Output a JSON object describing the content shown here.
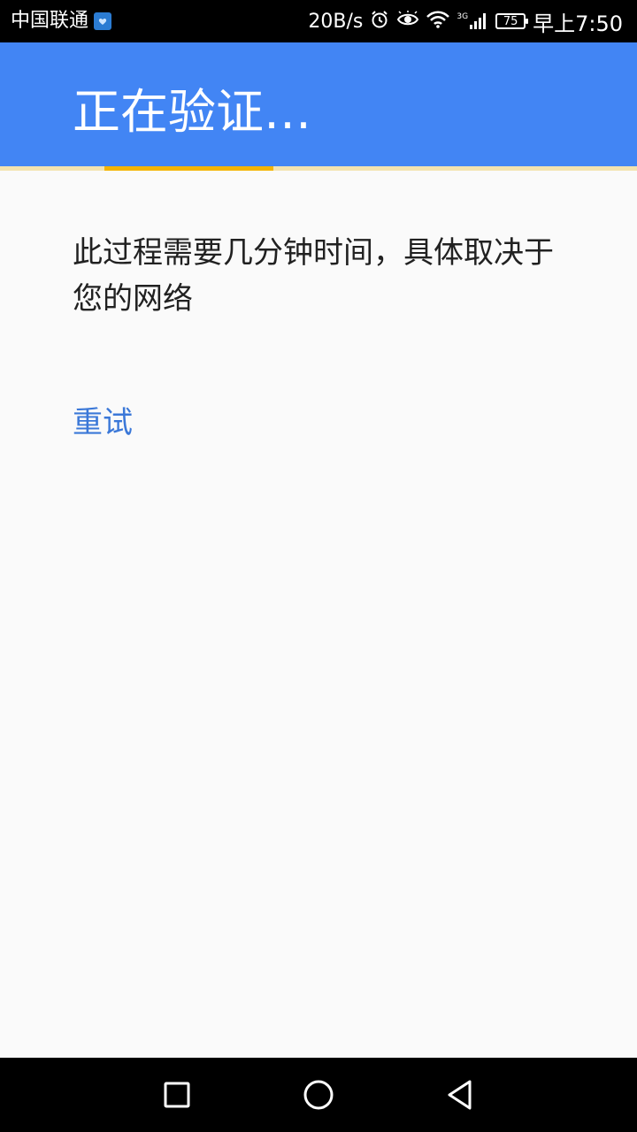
{
  "status_bar": {
    "carrier": "中国联通",
    "speed": "20B/s",
    "network_type": "3G",
    "battery": "75",
    "time": "早上7:50",
    "icons": [
      "carrier-badge-icon",
      "alarm-icon",
      "eye-icon",
      "wifi-icon",
      "signal-icon",
      "battery-icon"
    ]
  },
  "toolbar": {
    "title": "正在验证…",
    "background_color": "#4285f4"
  },
  "progress": {
    "indeterminate": true,
    "track_color": "#f3e3b0",
    "bar_color": "#f4b400"
  },
  "content": {
    "message": "此过程需要几分钟时间，具体取决于您的网络",
    "retry_label": "重试",
    "retry_color": "#3b78d8"
  },
  "nav_bar": {
    "buttons": [
      "recent-apps-icon",
      "home-icon",
      "back-icon"
    ]
  }
}
